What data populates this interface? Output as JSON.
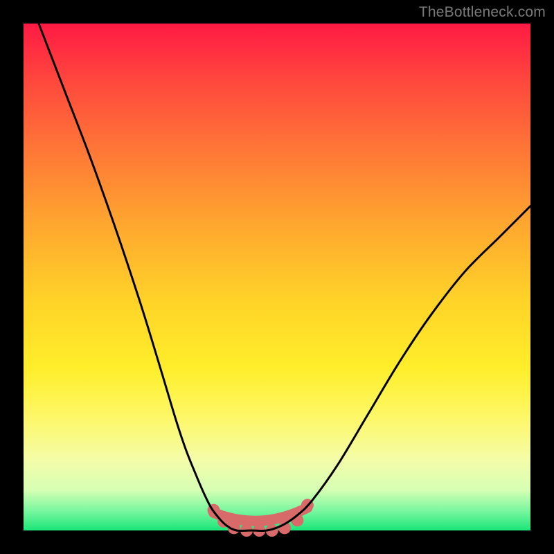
{
  "watermark": "TheBottleneck.com",
  "chart_data": {
    "type": "line",
    "title": "",
    "xlabel": "",
    "ylabel": "",
    "xlim": [
      0,
      1
    ],
    "ylim": [
      0,
      1
    ],
    "series": [
      {
        "name": "bottleneck-curve",
        "stroke": "#000000",
        "stroke_width": 3,
        "x": [
          0.03,
          0.08,
          0.13,
          0.18,
          0.23,
          0.27,
          0.3,
          0.32,
          0.34,
          0.355,
          0.37,
          0.385,
          0.4,
          0.42,
          0.45,
          0.48,
          0.51,
          0.54,
          0.57,
          0.62,
          0.68,
          0.74,
          0.8,
          0.87,
          0.94,
          1.0
        ],
        "y": [
          1.0,
          0.87,
          0.74,
          0.6,
          0.45,
          0.32,
          0.22,
          0.16,
          0.11,
          0.075,
          0.045,
          0.025,
          0.01,
          0.0,
          0.0,
          0.0,
          0.01,
          0.03,
          0.06,
          0.13,
          0.23,
          0.33,
          0.42,
          0.51,
          0.58,
          0.64
        ]
      },
      {
        "name": "optimum-band-markers",
        "type": "scatter",
        "color": "#d86a6a",
        "radius": 9,
        "x": [
          0.375,
          0.395,
          0.415,
          0.44,
          0.465,
          0.49,
          0.515,
          0.54,
          0.56
        ],
        "y": [
          0.04,
          0.018,
          0.005,
          0.0,
          0.0,
          0.0,
          0.005,
          0.02,
          0.05
        ]
      }
    ],
    "base_stroke": {
      "color": "#d86a6a",
      "width": 15,
      "x_range": [
        0.375,
        0.56
      ],
      "y": 0.0
    }
  }
}
